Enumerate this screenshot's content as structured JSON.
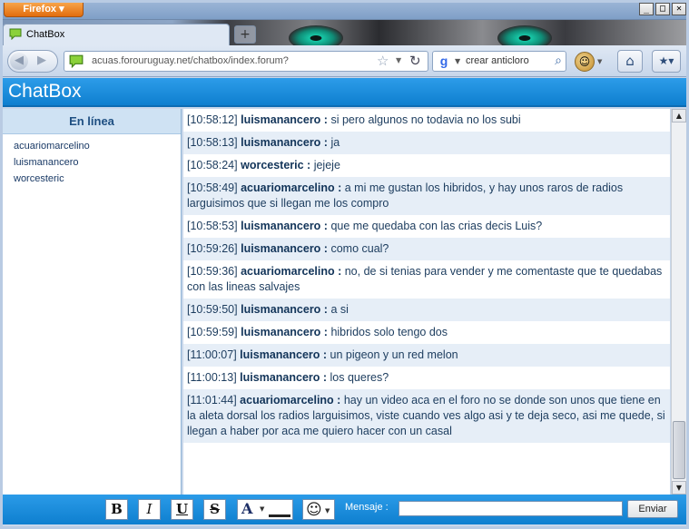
{
  "browser": {
    "menu_button": "Firefox",
    "window_controls": {
      "minimize": "_",
      "maximize": "□",
      "close": "✕"
    },
    "tab": {
      "title": "ChatBox",
      "icon": "speech-bubble-icon"
    },
    "new_tab": "+",
    "url": "acuas.forouruguay.net/chatbox/index.forum?",
    "search_text": "crear anticloro",
    "search_engine": "Google"
  },
  "chat": {
    "title": "ChatBox",
    "online": {
      "heading": "En línea",
      "users": [
        "acuariomarcelino",
        "luismanancero",
        "worcesteric"
      ]
    },
    "messages": [
      {
        "time": "[10:58:12]",
        "nick": "luismanancero :",
        "text": "si pero algunos no todavia no los subi"
      },
      {
        "time": "[10:58:13]",
        "nick": "luismanancero :",
        "text": "ja"
      },
      {
        "time": "[10:58:24]",
        "nick": "worcesteric :",
        "text": "jejeje"
      },
      {
        "time": "[10:58:49]",
        "nick": "acuariomarcelino :",
        "text": "a mi me gustan los hibridos, y hay unos raros de radios larguisimos que si llegan me los compro"
      },
      {
        "time": "[10:58:53]",
        "nick": "luismanancero :",
        "text": "que me quedaba con las crias decis Luis?"
      },
      {
        "time": "[10:59:26]",
        "nick": "luismanancero :",
        "text": "como cual?"
      },
      {
        "time": "[10:59:36]",
        "nick": "acuariomarcelino :",
        "text": "no, de si tenias para vender y me comentaste que te quedabas con las lineas salvajes"
      },
      {
        "time": "[10:59:50]",
        "nick": "luismanancero :",
        "text": "a si"
      },
      {
        "time": "[10:59:59]",
        "nick": "luismanancero :",
        "text": "hibridos solo tengo dos"
      },
      {
        "time": "[11:00:07]",
        "nick": "luismanancero :",
        "text": "un pigeon y un red melon"
      },
      {
        "time": "[11:00:13]",
        "nick": "luismanancero :",
        "text": "los queres?"
      },
      {
        "time": "[11:01:44]",
        "nick": "acuariomarcelino :",
        "text": "hay un video aca en el foro no se donde son unos que tiene en la aleta dorsal los radios larguisimos, viste cuando ves algo asi y te deja seco, asi me quede, si llegan a haber por aca me quiero hacer con un casal"
      }
    ],
    "toolbar": {
      "bold": "B",
      "italic": "I",
      "underline": "U",
      "strike": "S",
      "color_letter": "A",
      "message_label": "Mensaje :",
      "message_value": "",
      "send": "Enviar"
    }
  },
  "colors": {
    "header_blue": "#1a8ad9",
    "message_alt_row": "#e6eef7",
    "nick_text": "#123459"
  }
}
